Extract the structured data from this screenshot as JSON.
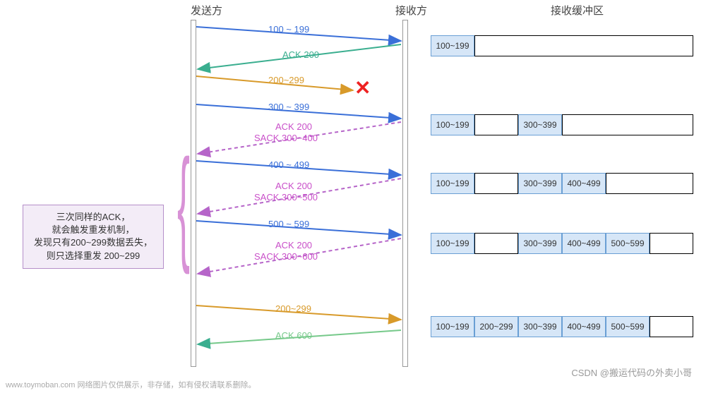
{
  "headers": {
    "sender": "发送方",
    "receiver": "接收方",
    "buffer": "接收缓冲区"
  },
  "seq": {
    "m1": "100 ~ 199",
    "a1": "ACK 200",
    "m2": "200~299",
    "m3": "300 ~ 399",
    "a3a": "ACK 200",
    "a3b": "SACK 300~400",
    "m4": "400 ~ 499",
    "a4a": "ACK 200",
    "a4b": "SACK 300~500",
    "m5": "500 ~ 599",
    "a5a": "ACK 200",
    "a5b": "SACK 300~600",
    "m6": "200~299",
    "a6": "ACK 600"
  },
  "note": {
    "l1": "三次同样的ACK，",
    "l2": "就会触发重发机制，",
    "l3": "发现只有200~299数据丢失，",
    "l4": "则只选择重发 200~299"
  },
  "buf": {
    "r1": [
      "100~199",
      "",
      "",
      "",
      "",
      ""
    ],
    "r2": [
      "100~199",
      "",
      "300~399",
      "",
      "",
      ""
    ],
    "r3": [
      "100~199",
      "",
      "300~399",
      "400~499",
      "",
      ""
    ],
    "r4": [
      "100~199",
      "",
      "300~399",
      "400~499",
      "500~599",
      ""
    ],
    "r5": [
      "100~199",
      "200~299",
      "300~399",
      "400~499",
      "500~599",
      ""
    ]
  },
  "footer": "www.toymoban.com  网络图片仅供展示，非存储，如有侵权请联系删除。",
  "credit": "CSDN @搬运代码の外卖小哥",
  "chart_data": {
    "type": "sequence-diagram",
    "actors": [
      "发送方",
      "接收方"
    ],
    "messages": [
      {
        "from": "发送方",
        "to": "接收方",
        "label": "100 ~ 199",
        "color": "blue"
      },
      {
        "from": "接收方",
        "to": "发送方",
        "label": "ACK 200",
        "color": "green"
      },
      {
        "from": "发送方",
        "to": "接收方",
        "label": "200~299",
        "color": "orange",
        "lost": true
      },
      {
        "from": "发送方",
        "to": "接收方",
        "label": "300 ~ 399",
        "color": "blue"
      },
      {
        "from": "接收方",
        "to": "发送方",
        "label": "ACK 200 / SACK 300~400",
        "color": "magenta",
        "dashed": true
      },
      {
        "from": "发送方",
        "to": "接收方",
        "label": "400 ~ 499",
        "color": "blue"
      },
      {
        "from": "接收方",
        "to": "发送方",
        "label": "ACK 200 / SACK 300~500",
        "color": "magenta",
        "dashed": true
      },
      {
        "from": "发送方",
        "to": "接收方",
        "label": "500 ~ 599",
        "color": "blue"
      },
      {
        "from": "接收方",
        "to": "发送方",
        "label": "ACK 200 / SACK 300~600",
        "color": "magenta",
        "dashed": true
      },
      {
        "from": "发送方",
        "to": "接收方",
        "label": "200~299",
        "color": "orange"
      },
      {
        "from": "接收方",
        "to": "发送方",
        "label": "ACK 600",
        "color": "green"
      }
    ],
    "buffer_states": [
      [
        "100~199"
      ],
      [
        "100~199",
        null,
        "300~399"
      ],
      [
        "100~199",
        null,
        "300~399",
        "400~499"
      ],
      [
        "100~199",
        null,
        "300~399",
        "400~499",
        "500~599"
      ],
      [
        "100~199",
        "200~299",
        "300~399",
        "400~499",
        "500~599"
      ]
    ],
    "note": "三次同样的ACK，就会触发重发机制，发现只有200~299数据丢失，则只选择重发 200~299"
  }
}
